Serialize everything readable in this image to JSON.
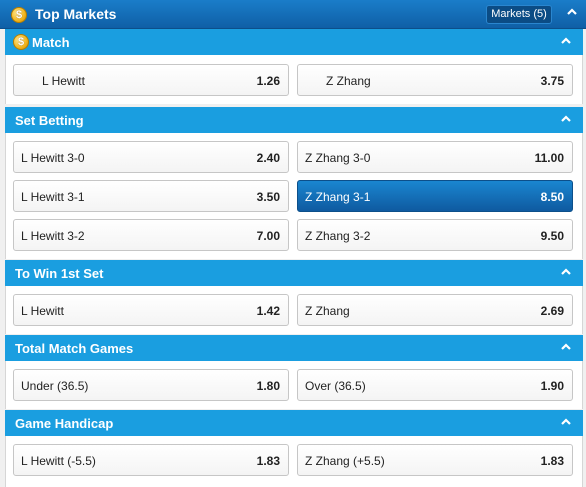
{
  "top": {
    "title": "Top Markets",
    "markets_btn": "Markets (5)"
  },
  "sections": [
    {
      "title": "Match",
      "rows": [
        [
          {
            "name": "L Hewitt",
            "odds": "1.26"
          },
          {
            "name": "Z Zhang",
            "odds": "3.75"
          }
        ]
      ]
    },
    {
      "title": "Set Betting",
      "rows": [
        [
          {
            "name": "L Hewitt 3-0",
            "odds": "2.40"
          },
          {
            "name": "Z Zhang 3-0",
            "odds": "11.00"
          }
        ],
        [
          {
            "name": "L Hewitt 3-1",
            "odds": "3.50"
          },
          {
            "name": "Z Zhang 3-1",
            "odds": "8.50"
          }
        ],
        [
          {
            "name": "L Hewitt 3-2",
            "odds": "7.00"
          },
          {
            "name": "Z Zhang 3-2",
            "odds": "9.50"
          }
        ]
      ]
    },
    {
      "title": "To Win 1st Set",
      "rows": [
        [
          {
            "name": "L Hewitt",
            "odds": "1.42"
          },
          {
            "name": "Z Zhang",
            "odds": "2.69"
          }
        ]
      ]
    },
    {
      "title": "Total Match Games",
      "rows": [
        [
          {
            "name": "Under (36.5)",
            "odds": "1.80"
          },
          {
            "name": "Over (36.5)",
            "odds": "1.90"
          }
        ]
      ]
    },
    {
      "title": "Game Handicap",
      "rows": [
        [
          {
            "name": "L Hewitt (-5.5)",
            "odds": "1.83"
          },
          {
            "name": "Z Zhang (+5.5)",
            "odds": "1.83"
          }
        ]
      ]
    }
  ],
  "colors": {
    "header_bar": "#1a9ee0",
    "top_bar": "#0f5fa6",
    "selected": "#0f5aa0"
  },
  "icons": {
    "coin": "coin-icon",
    "collapse": "chevron-up-icon"
  },
  "coin_glyph": "$"
}
